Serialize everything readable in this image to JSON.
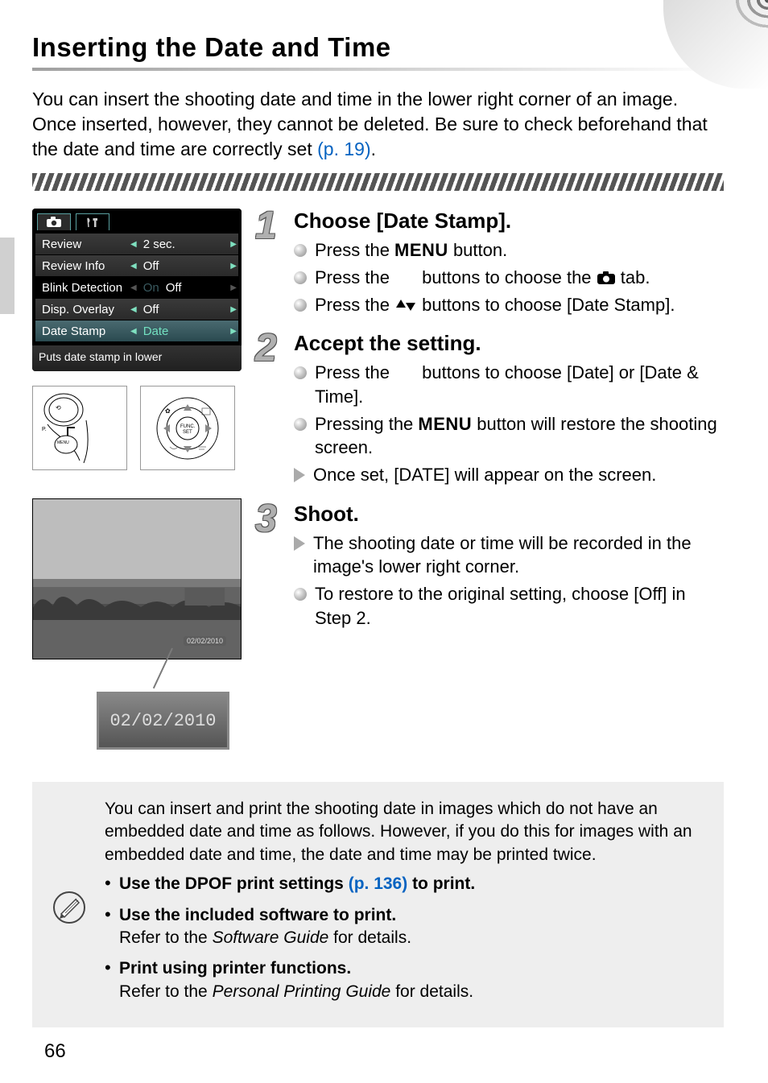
{
  "title": "Inserting the Date and Time",
  "intro_before_link": "You can insert the shooting date and time in the lower right corner of an image. Once inserted, however, they cannot be deleted. Be sure to check beforehand that the date and time are correctly set ",
  "intro_link": "(p. 19)",
  "intro_after_link": ".",
  "lcd": {
    "rows": [
      {
        "label": "Review",
        "value": "2 sec.",
        "left_tri": true,
        "right_tri": true,
        "selected": false
      },
      {
        "label": "Review Info",
        "value": "Off",
        "left_tri": true,
        "right_tri": true,
        "selected": false
      },
      {
        "label": "Blink Detection",
        "on": "On",
        "value": "Off",
        "left_tri": false,
        "right_tri": false,
        "selected": false,
        "nobg": true
      },
      {
        "label": "Disp. Overlay",
        "value": "Off",
        "left_tri": true,
        "right_tri": true,
        "selected": false
      },
      {
        "label": "Date Stamp",
        "value": "Date",
        "left_tri": true,
        "right_tri": true,
        "selected": true
      }
    ],
    "help": "Puts date stamp in lower"
  },
  "callout_date": "02/02/2010",
  "photo_date": "02/02/2010",
  "steps": [
    {
      "num": "1",
      "title": "Choose [Date Stamp].",
      "items": [
        {
          "kind": "dot",
          "parts": [
            "Press the ",
            {
              "icon": "menu-word",
              "text": "MENU"
            },
            " button."
          ]
        },
        {
          "kind": "dot",
          "parts": [
            "Press the ",
            {
              "icon": "lr-arrows"
            },
            " buttons to choose the ",
            {
              "icon": "camera"
            },
            " tab."
          ]
        },
        {
          "kind": "dot",
          "parts": [
            "Press the ",
            {
              "icon": "ud-arrows"
            },
            " buttons to choose [Date Stamp]."
          ]
        }
      ]
    },
    {
      "num": "2",
      "title": "Accept the setting.",
      "items": [
        {
          "kind": "dot",
          "parts": [
            "Press the ",
            {
              "icon": "lr-arrows"
            },
            " buttons to choose [Date] or [Date & Time]."
          ]
        },
        {
          "kind": "dot",
          "parts": [
            "Pressing the ",
            {
              "icon": "menu-word",
              "text": "MENU"
            },
            " button will restore the shooting screen."
          ]
        },
        {
          "kind": "tri",
          "parts": [
            "Once set, [DATE] will appear on the screen."
          ]
        }
      ]
    },
    {
      "num": "3",
      "title": "Shoot.",
      "items": [
        {
          "kind": "tri",
          "parts": [
            "The shooting date or time will be recorded in the image's lower right corner."
          ]
        },
        {
          "kind": "dot",
          "parts": [
            "To restore to the original setting, choose [Off] in Step 2."
          ]
        }
      ]
    }
  ],
  "tips": {
    "intro": "You can insert and print the shooting date in images which do not have an embedded date and time as follows. However, if you do this for images with an embedded date and time, the date and time may be printed twice.",
    "items": [
      {
        "bold_before": "Use the DPOF print settings ",
        "link": "(p. 136)",
        "bold_after": " to print."
      },
      {
        "bold": "Use the included software to print.",
        "sub_before": "Refer to the ",
        "sub_em": "Software Guide",
        "sub_after": " for details."
      },
      {
        "bold": "Print using printer functions.",
        "sub_before": "Refer to the ",
        "sub_em": "Personal Printing Guide",
        "sub_after": " for details."
      }
    ]
  },
  "page_number": "66"
}
